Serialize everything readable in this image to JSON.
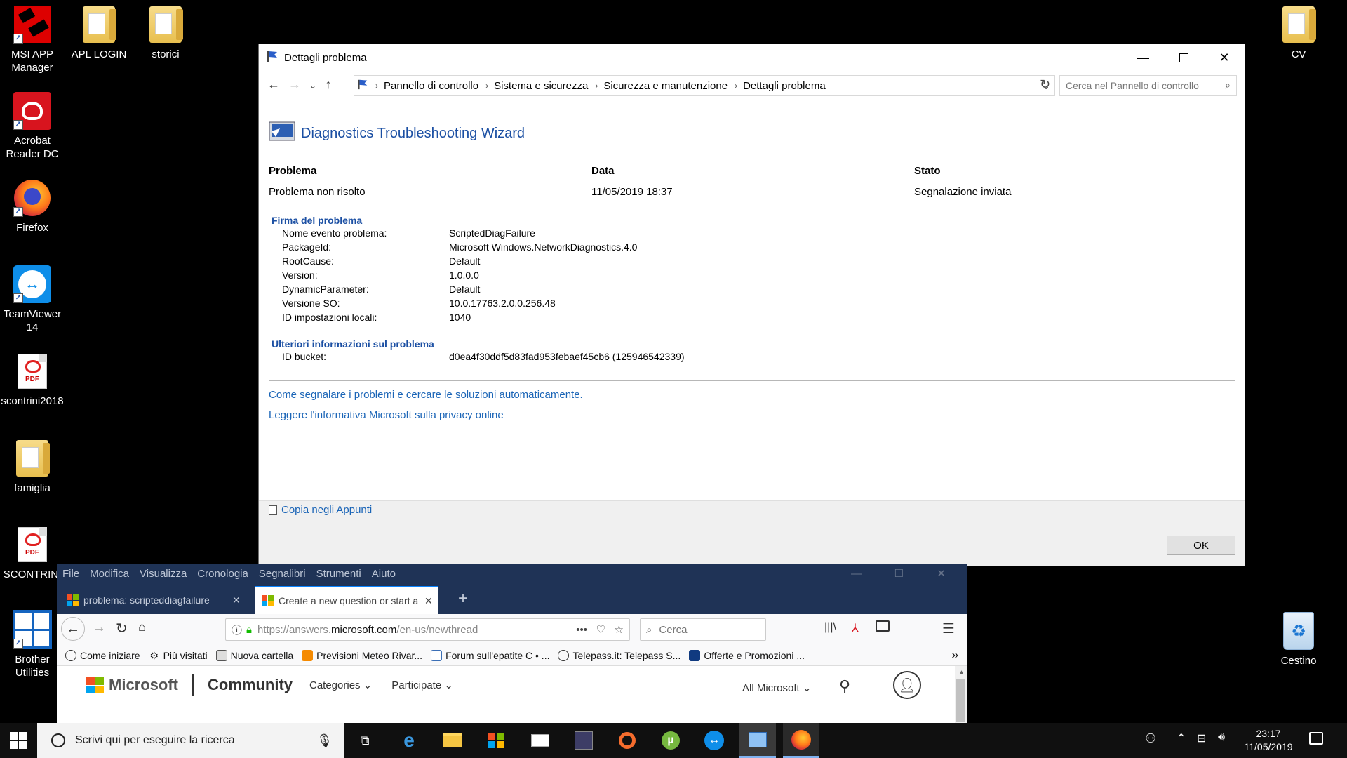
{
  "desktop": {
    "icons": [
      {
        "label": "MSI APP Manager"
      },
      {
        "label": "APL LOGIN"
      },
      {
        "label": "storici"
      },
      {
        "label": "Acrobat Reader DC"
      },
      {
        "label": "Firefox"
      },
      {
        "label": "TeamViewer 14"
      },
      {
        "label": "scontrini2018"
      },
      {
        "label": "famiglia"
      },
      {
        "label": "SCONTRINI"
      },
      {
        "label": "Brother Utilities"
      },
      {
        "label": "CV"
      },
      {
        "label": "Cestino"
      }
    ],
    "pdf_badge": "PDF"
  },
  "dialog": {
    "title": "Dettagli problema",
    "breadcrumb": [
      "Pannello di controllo",
      "Sistema e sicurezza",
      "Sicurezza e manutenzione",
      "Dettagli problema"
    ],
    "search_placeholder": "Cerca nel Pannello di controllo",
    "wizard_title": "Diagnostics Troubleshooting Wizard",
    "columns": {
      "problem_header": "Problema",
      "problem_value": "Problema non risolto",
      "date_header": "Data",
      "date_value": "11/05/2019 18:37",
      "status_header": "Stato",
      "status_value": "Segnalazione inviata"
    },
    "signature": {
      "header": "Firma del problema",
      "rows": [
        {
          "key": "Nome evento problema:",
          "value": "ScriptedDiagFailure"
        },
        {
          "key": "PackageId:",
          "value": "Microsoft Windows.NetworkDiagnostics.4.0"
        },
        {
          "key": "RootCause:",
          "value": "Default"
        },
        {
          "key": "Version:",
          "value": "1.0.0.0"
        },
        {
          "key": "DynamicParameter:",
          "value": "Default"
        },
        {
          "key": "Versione SO:",
          "value": "10.0.17763.2.0.0.256.48"
        },
        {
          "key": "ID impostazioni locali:",
          "value": "1040"
        }
      ],
      "extra_header": "Ulteriori informazioni sul problema",
      "bucket_key": "ID bucket:",
      "bucket_value": "d0ea4f30ddf5d83fad953febaef45cb6 (125946542339)"
    },
    "link_report": "Come segnalare i problemi e cercare le soluzioni automaticamente.",
    "link_privacy": "Leggere l'informativa Microsoft sulla privacy online",
    "copy_label": "Copia negli Appunti",
    "ok_label": "OK"
  },
  "firefox": {
    "menu": [
      "File",
      "Modifica",
      "Visualizza",
      "Cronologia",
      "Segnalibri",
      "Strumenti",
      "Aiuto"
    ],
    "tabs": [
      {
        "title": "problema: scripteddiagfailure"
      },
      {
        "title": "Create a new question or start a"
      }
    ],
    "url_prefix": "https://answers.",
    "url_domain": "microsoft.com",
    "url_suffix": "/en-us/newthread",
    "search_placeholder": "Cerca",
    "bookmarks": [
      "Come iniziare",
      "Più visitati",
      "Nuova cartella",
      "Previsioni Meteo Rivar...",
      "Forum sull'epatite C • ...",
      "Telepass.it: Telepass S...",
      "Offerte e Promozioni ..."
    ],
    "page": {
      "brand": "Microsoft",
      "community": "Community",
      "nav": [
        "Categories",
        "Participate"
      ],
      "all_microsoft": "All Microsoft"
    }
  },
  "taskbar": {
    "search_placeholder": "Scrivi qui per eseguire la ricerca",
    "time": "23:17",
    "date": "11/05/2019"
  },
  "colors": {
    "link_blue": "#1b65b7",
    "firefox_frame": "#1f3356",
    "taskbar": "#101010"
  }
}
